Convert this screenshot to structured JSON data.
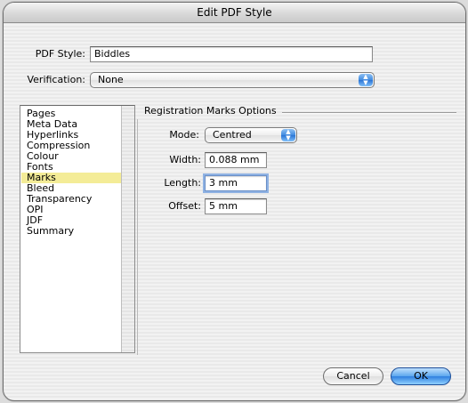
{
  "window": {
    "title": "Edit PDF Style"
  },
  "pdf_style": {
    "label": "PDF Style:",
    "value": "Biddles"
  },
  "verification": {
    "label": "Verification:",
    "value": "None",
    "icon": "updown-arrows-icon"
  },
  "sidebar": {
    "selected": "Marks",
    "items": [
      {
        "label": "Pages"
      },
      {
        "label": "Meta Data"
      },
      {
        "label": "Hyperlinks"
      },
      {
        "label": "Compression"
      },
      {
        "label": "Colour"
      },
      {
        "label": "Fonts"
      },
      {
        "label": "Marks"
      },
      {
        "label": "Bleed"
      },
      {
        "label": "Transparency"
      },
      {
        "label": "OPI"
      },
      {
        "label": "JDF"
      },
      {
        "label": "Summary"
      }
    ]
  },
  "registration": {
    "group_title": "Registration Marks Options",
    "mode": {
      "label": "Mode:",
      "value": "Centred"
    },
    "width": {
      "label": "Width:",
      "value": "0.088 mm"
    },
    "length": {
      "label": "Length:",
      "value": "3 mm"
    },
    "offset": {
      "label": "Offset:",
      "value": "5 mm"
    }
  },
  "buttons": {
    "cancel": "Cancel",
    "ok": "OK"
  },
  "colors": {
    "selection": "#f4ec97",
    "accent": "#3f8ae0",
    "focus_ring": "#8fb2e3"
  }
}
